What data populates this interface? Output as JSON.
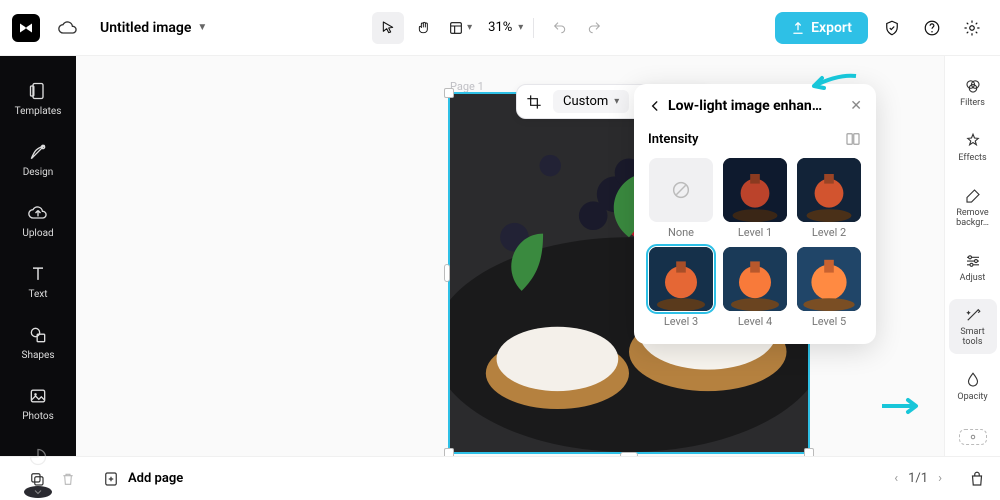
{
  "header": {
    "title": "Untitled image",
    "zoom": "31%",
    "export_label": "Export"
  },
  "leftnav": {
    "items": [
      {
        "label": "Templates",
        "icon": "templates-icon"
      },
      {
        "label": "Design",
        "icon": "design-icon"
      },
      {
        "label": "Upload",
        "icon": "upload-icon"
      },
      {
        "label": "Text",
        "icon": "text-icon"
      },
      {
        "label": "Shapes",
        "icon": "shapes-icon"
      },
      {
        "label": "Photos",
        "icon": "photos-icon"
      }
    ]
  },
  "canvas": {
    "page_label": "Page 1",
    "crop_mode": "Custom"
  },
  "panel": {
    "title": "Low-light image enhan…",
    "section": "Intensity",
    "thumbs": [
      {
        "label": "None"
      },
      {
        "label": "Level 1"
      },
      {
        "label": "Level 2"
      },
      {
        "label": "Level 3"
      },
      {
        "label": "Level 4"
      },
      {
        "label": "Level 5"
      }
    ],
    "selected_index": 3
  },
  "rightrail": {
    "items": [
      {
        "label": "Filters"
      },
      {
        "label": "Effects"
      },
      {
        "label": "Remove backgr…"
      },
      {
        "label": "Adjust"
      },
      {
        "label": "Smart tools"
      },
      {
        "label": "Opacity"
      }
    ],
    "active_index": 4
  },
  "bottom": {
    "addpage_label": "Add page",
    "page_indicator": "1/1"
  },
  "colors": {
    "accent": "#2ec0e6",
    "annotation": "#18c6d9"
  }
}
